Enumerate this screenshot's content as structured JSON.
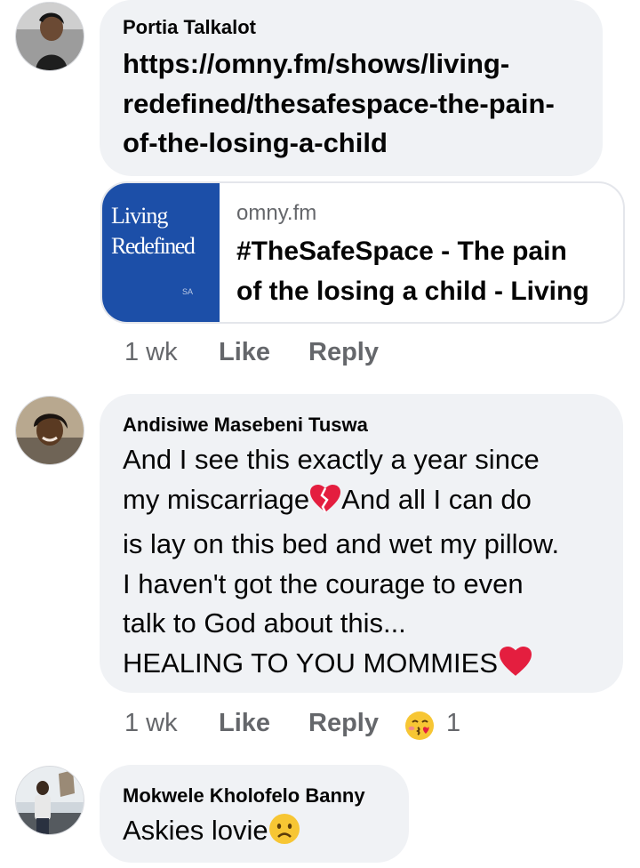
{
  "comments": [
    {
      "author": "Portia Talkalot",
      "text_lines": [
        "https://omny.fm/shows/living-",
        "redefined/thesafespace-the-pain-",
        "of-the-losing-a-child"
      ],
      "link_preview": {
        "thumbnail_line1": "Living",
        "thumbnail_line2": "Redefined",
        "thumbnail_badge": "SA",
        "domain": "omny.fm",
        "title_line1": "#TheSafeSpace - The pain",
        "title_line2": "of the losing a child - Living"
      },
      "time": "1 wk",
      "like_label": "Like",
      "reply_label": "Reply"
    },
    {
      "author": "Andisiwe Masebeni Tuswa",
      "text_lines": [
        "And I see this exactly a year since",
        "my miscarriage",
        "And all I can do",
        "is lay on this bed and wet my pillow.",
        "I haven't got the courage to even",
        "talk to God about this...",
        "HEALING TO YOU MOMMIES"
      ],
      "emojis": [
        "broken-heart-icon",
        "red-heart-icon"
      ],
      "time": "1 wk",
      "like_label": "Like",
      "reply_label": "Reply",
      "reaction_icon": "kissing-face-icon",
      "reaction_count": "1"
    },
    {
      "author": "Mokwele Kholofelo Banny",
      "text": "Askies lovie",
      "emoji": "frowning-face-icon"
    }
  ],
  "colors": {
    "bubble": "#f0f2f5",
    "meta": "#65676b",
    "text": "#050505",
    "thumbnail": "#1c4fa8",
    "heart": "#e41e3f"
  }
}
